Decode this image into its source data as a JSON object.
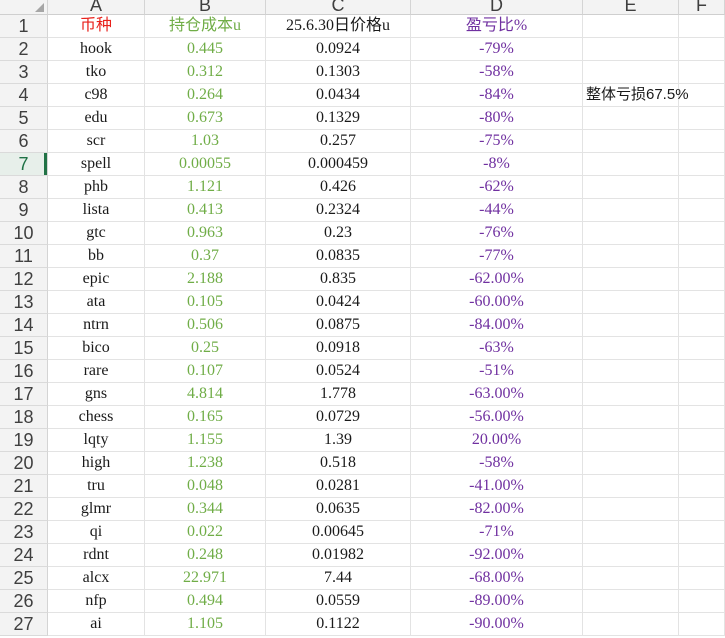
{
  "columns": [
    "A",
    "B",
    "C",
    "D",
    "E",
    "F"
  ],
  "header_row": {
    "row_number": "1",
    "a": "币种",
    "b": "持仓成本u",
    "c": "25.6.30日价格u",
    "d": "盈亏比%"
  },
  "summary_note": "整体亏损67.5%",
  "rows": [
    {
      "n": "2",
      "a": "hook",
      "b": "0.445",
      "c": "0.0924",
      "d": "-79%"
    },
    {
      "n": "3",
      "a": "tko",
      "b": "0.312",
      "c": "0.1303",
      "d": "-58%"
    },
    {
      "n": "4",
      "a": "c98",
      "b": "0.264",
      "c": "0.0434",
      "d": "-84%"
    },
    {
      "n": "5",
      "a": "edu",
      "b": "0.673",
      "c": "0.1329",
      "d": "-80%"
    },
    {
      "n": "6",
      "a": "scr",
      "b": "1.03",
      "c": "0.257",
      "d": "-75%"
    },
    {
      "n": "7",
      "a": "spell",
      "b": "0.00055",
      "c": "0.000459",
      "d": "-8%"
    },
    {
      "n": "8",
      "a": "phb",
      "b": "1.121",
      "c": "0.426",
      "d": "-62%"
    },
    {
      "n": "9",
      "a": "lista",
      "b": "0.413",
      "c": "0.2324",
      "d": "-44%"
    },
    {
      "n": "10",
      "a": "gtc",
      "b": "0.963",
      "c": "0.23",
      "d": "-76%"
    },
    {
      "n": "11",
      "a": "bb",
      "b": "0.37",
      "c": "0.0835",
      "d": "-77%"
    },
    {
      "n": "12",
      "a": "epic",
      "b": "2.188",
      "c": "0.835",
      "d": "-62.00%"
    },
    {
      "n": "13",
      "a": "ata",
      "b": "0.105",
      "c": "0.0424",
      "d": "-60.00%"
    },
    {
      "n": "14",
      "a": "ntrn",
      "b": "0.506",
      "c": "0.0875",
      "d": "-84.00%"
    },
    {
      "n": "15",
      "a": "bico",
      "b": "0.25",
      "c": "0.0918",
      "d": "-63%"
    },
    {
      "n": "16",
      "a": "rare",
      "b": "0.107",
      "c": "0.0524",
      "d": "-51%"
    },
    {
      "n": "17",
      "a": "gns",
      "b": "4.814",
      "c": "1.778",
      "d": "-63.00%"
    },
    {
      "n": "18",
      "a": "chess",
      "b": "0.165",
      "c": "0.0729",
      "d": "-56.00%"
    },
    {
      "n": "19",
      "a": "lqty",
      "b": "1.155",
      "c": "1.39",
      "d": "20.00%"
    },
    {
      "n": "20",
      "a": "high",
      "b": "1.238",
      "c": "0.518",
      "d": "-58%"
    },
    {
      "n": "21",
      "a": "tru",
      "b": "0.048",
      "c": "0.0281",
      "d": "-41.00%"
    },
    {
      "n": "22",
      "a": "glmr",
      "b": "0.344",
      "c": "0.0635",
      "d": "-82.00%"
    },
    {
      "n": "23",
      "a": "qi",
      "b": "0.022",
      "c": "0.00645",
      "d": "-71%"
    },
    {
      "n": "24",
      "a": "rdnt",
      "b": "0.248",
      "c": "0.01982",
      "d": "-92.00%"
    },
    {
      "n": "25",
      "a": "alcx",
      "b": "22.971",
      "c": "7.44",
      "d": "-68.00%"
    },
    {
      "n": "26",
      "a": "nfp",
      "b": "0.494",
      "c": "0.0559",
      "d": "-89.00%"
    },
    {
      "n": "27",
      "a": "ai",
      "b": "1.105",
      "c": "0.1122",
      "d": "-90.00%"
    }
  ],
  "active_row": "7"
}
